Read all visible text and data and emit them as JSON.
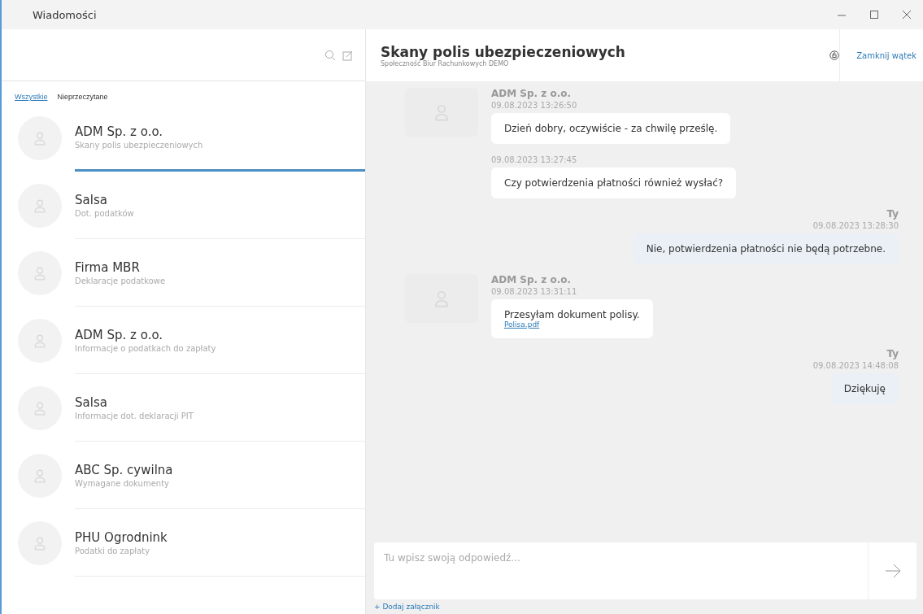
{
  "window": {
    "title": "Wiadomości"
  },
  "filters": [
    {
      "label": "Wszystkie",
      "selected": true
    },
    {
      "label": "Nieprzeczytane",
      "selected": false
    }
  ],
  "conversations": [
    {
      "name": "ADM Sp. z o.o.",
      "subject": "Skany polis ubezpieczeniowych",
      "selected": true
    },
    {
      "name": "Salsa",
      "subject": "Dot. podatków",
      "selected": false
    },
    {
      "name": "Firma MBR",
      "subject": "Deklaracje podatkowe",
      "selected": false
    },
    {
      "name": "ADM Sp. z o.o.",
      "subject": "Informacje o podatkach do zapłaty",
      "selected": false
    },
    {
      "name": "Salsa",
      "subject": "Informacje dot. deklaracji PIT",
      "selected": false
    },
    {
      "name": "ABC Sp. cywilna",
      "subject": "Wymagane dokumenty",
      "selected": false
    },
    {
      "name": "PHU Ogrodnink",
      "subject": "Podatki do zapłaty",
      "selected": false
    }
  ],
  "thread": {
    "title": "Skany polis ubezpieczeniowych",
    "community": "Społeczność Biur Rachunkowych DEMO",
    "close_label": "Zamknij wątek"
  },
  "messages": [
    {
      "kind": "incoming",
      "sender": "ADM Sp. z o.o.",
      "time": "09.08.2023 13:26:50",
      "text": "Dzień dobry, oczywiście - za chwilę prześlę."
    },
    {
      "kind": "incoming",
      "time": "09.08.2023 13:27:45",
      "text": "Czy potwierdzenia płatności również wysłać?"
    },
    {
      "kind": "outgoing",
      "sender": "Ty",
      "time": "09.08.2023 13:28:30",
      "text": "Nie, potwierdzenia płatności nie będą potrzebne."
    },
    {
      "kind": "incoming",
      "sender": "ADM Sp. z o.o.",
      "time": "09.08.2023 13:31:11",
      "text": "Przesyłam dokument polisy.",
      "attachment": "Polisa.pdf"
    },
    {
      "kind": "outgoing",
      "sender": "Ty",
      "time": "09.08.2023 14:48:08",
      "text": "Dziękuję"
    }
  ],
  "reply": {
    "placeholder": "Tu wpisz swoją odpowiedź...",
    "attach_label": "+ Dodaj załącznik"
  }
}
